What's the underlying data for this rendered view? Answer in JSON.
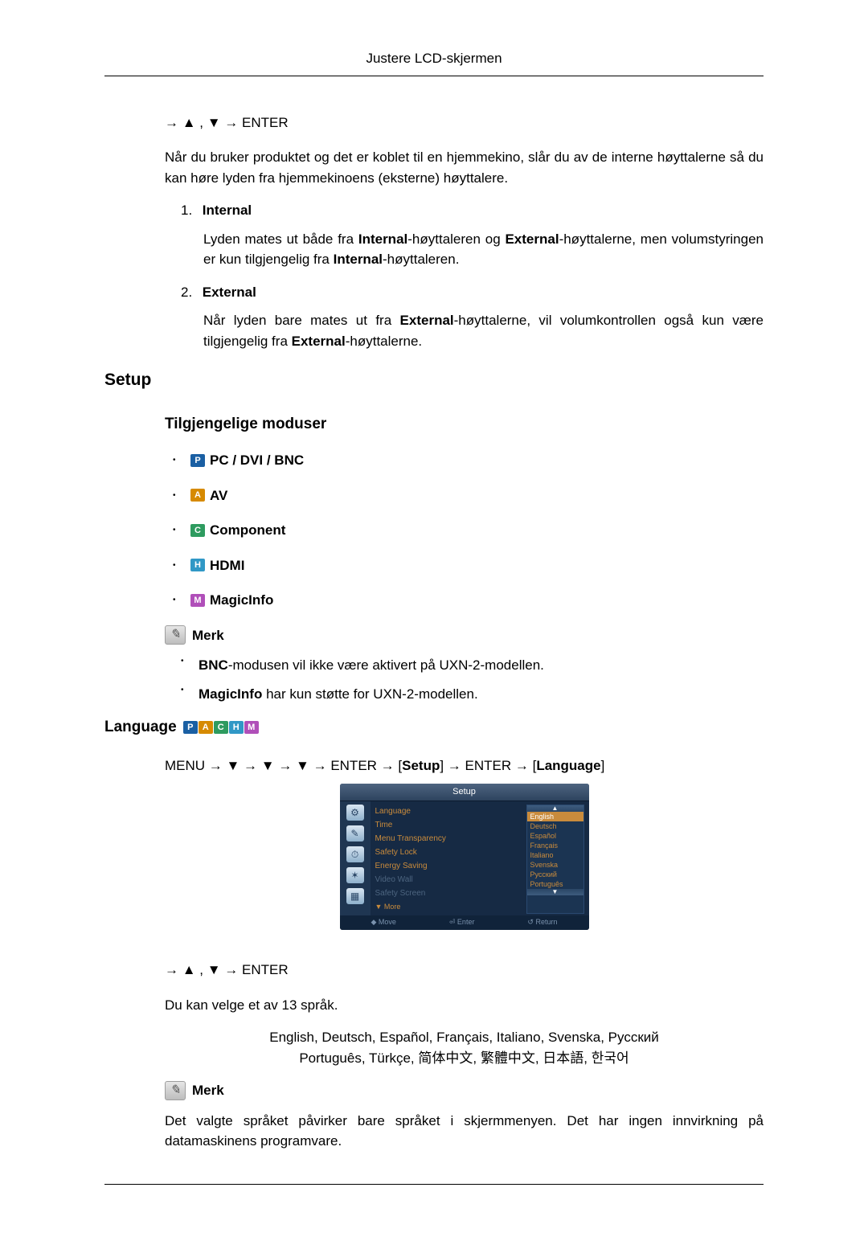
{
  "header": {
    "title": "Justere LCD-skjermen"
  },
  "nav1": "→ ▲ , ▼ → ENTER",
  "intro_para": "Når du bruker produktet og det er koblet til en hjemmekino, slår du av de interne høyttalerne så du kan høre lyden fra hjemmekinoens (eksterne) høyttalere.",
  "list1": {
    "num1": "1.",
    "title1": "Internal",
    "body1_a": "Lyden mates ut både fra ",
    "body1_b": "Internal",
    "body1_c": "-høyttaleren og ",
    "body1_d": "External",
    "body1_e": "-høyttalerne, men volumstyringen er kun tilgjengelig fra ",
    "body1_f": "Internal",
    "body1_g": "-høyttaleren.",
    "num2": "2.",
    "title2": "External",
    "body2_a": "Når lyden bare mates ut fra ",
    "body2_b": "External",
    "body2_c": "-høyttalerne, vil volumkontrollen også kun være tilgjengelig fra ",
    "body2_d": "External",
    "body2_e": "-høyttalerne."
  },
  "setup_heading": "Setup",
  "modes_heading": "Tilgjengelige moduser",
  "modes": {
    "pc": "PC / DVI / BNC",
    "av": "AV",
    "component": "Component",
    "hdmi": "HDMI",
    "magicinfo": "MagicInfo"
  },
  "icon_letters": {
    "P": "P",
    "A": "A",
    "C": "C",
    "H": "H",
    "M": "M"
  },
  "merk_label": "Merk",
  "merk_notes": {
    "n1_a": "BNC",
    "n1_b": "-modusen vil ikke være aktivert på UXN-2-modellen.",
    "n2_a": "MagicInfo",
    "n2_b": " har kun støtte for UXN-2-modellen."
  },
  "language_heading": "Language",
  "menu_path": {
    "p1": "MENU → ▼ → ▼ → ▼ → ENTER → [",
    "p2": "Setup",
    "p3": "] → ENTER → [",
    "p4": "Language",
    "p5": "]"
  },
  "osd": {
    "title": "Setup",
    "side_icons": [
      "⚙",
      "✎",
      "⏱",
      "✶",
      "▦"
    ],
    "menu": {
      "language": "Language",
      "time": "Time",
      "transparency": "Menu Transparency",
      "safety_lock": "Safety Lock",
      "energy": "Energy Saving",
      "video_wall": "Video Wall",
      "safety_screen": "Safety Screen",
      "more": "▼ More"
    },
    "lang_options": [
      "English",
      "Deutsch",
      "Español",
      "Français",
      "Italiano",
      "Svenska",
      "Русский",
      "Português"
    ],
    "arrow_up": "▲",
    "arrow_down": "▼",
    "footer": {
      "move": "◆ Move",
      "enter": "⏎ Enter",
      "return": "↺ Return"
    }
  },
  "nav2": "→ ▲ , ▼ → ENTER",
  "choose_lang": "Du kan velge et av 13 språk.",
  "lang_line1": "English, Deutsch, Español, Français, Italiano, Svenska, Русский",
  "lang_line2": "Português, Türkçe, 简体中文,   繁體中文, 日本語, 한국어",
  "merk2_label": "Merk",
  "merk2_body": "Det valgte språket påvirker bare språket i skjermmenyen. Det har ingen innvirkning på datamaskinens programvare."
}
